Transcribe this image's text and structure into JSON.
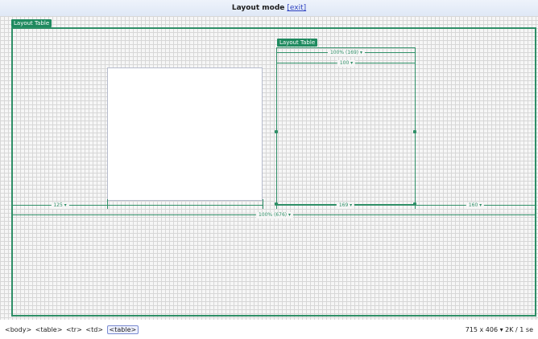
{
  "header": {
    "title": "Layout mode",
    "exit_label": "[exit]"
  },
  "outer_tab": "Layout Table",
  "inner_tab": "Layout Table",
  "measures": {
    "inner_top": "100% (169) ▾",
    "inner_second": "100 ▾",
    "col1": "125 ▾",
    "col2": "",
    "col3": "169 ▾",
    "col4": "160 ▾",
    "total": "100% (676) ▾"
  },
  "statusbar": {
    "crumbs": [
      "<body>",
      "<table>",
      "<tr>",
      "<td>",
      "<table>"
    ],
    "right": "715 x 406 ▾ 2K / 1 se"
  }
}
